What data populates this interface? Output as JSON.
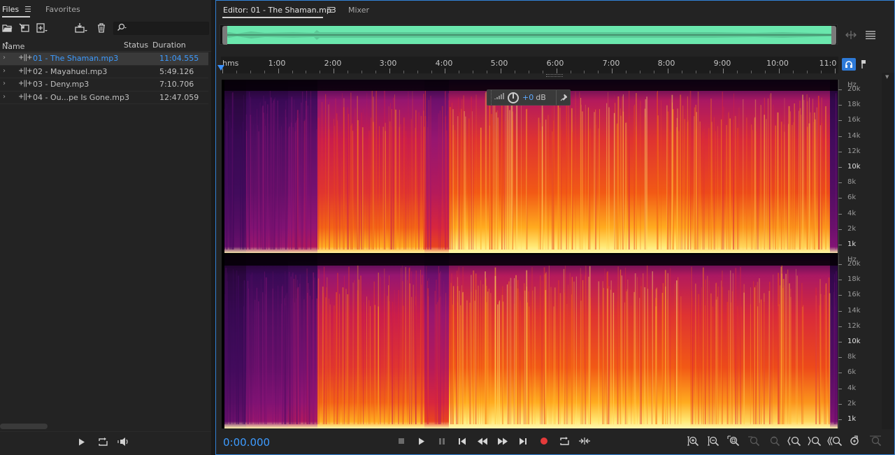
{
  "files_panel": {
    "tabs": [
      {
        "label": "Files",
        "active": true
      },
      {
        "label": "Favorites",
        "active": false
      }
    ],
    "toolbar": {
      "search_value": "",
      "icons": [
        "open-folder-icon",
        "import-icon",
        "new-file-icon",
        "insert-into-multitrack-icon",
        "delete-icon"
      ]
    },
    "columns": {
      "name": "Name",
      "sort_indicator": "↑",
      "status": "Status",
      "duration": "Duration"
    },
    "files": [
      {
        "name": "01 - The Shaman.mp3",
        "duration": "11:04.555",
        "selected": true
      },
      {
        "name": "02 - Mayahuel.mp3",
        "duration": "5:49.126",
        "selected": false
      },
      {
        "name": "03 - Deny.mp3",
        "duration": "7:10.706",
        "selected": false
      },
      {
        "name": "04 - Ou...pe Is Gone.mp3",
        "duration": "12:47.059",
        "selected": false
      }
    ]
  },
  "editor": {
    "tabs": [
      {
        "label": "Editor: 01 - The Shaman.mp3",
        "active": true
      },
      {
        "label": "Mixer",
        "active": false
      }
    ],
    "ruler": {
      "labels": [
        "hms",
        "1:00",
        "2:00",
        "3:00",
        "4:00",
        "5:00",
        "6:00",
        "7:00",
        "8:00",
        "9:00",
        "10:00",
        "11:0"
      ]
    },
    "hud": {
      "gain_value": "+0",
      "gain_unit": "dB"
    },
    "freq_axis": {
      "unit": "Hz",
      "labels": [
        "20k",
        "18k",
        "16k",
        "14k",
        "12k",
        "10k",
        "8k",
        "6k",
        "4k",
        "2k",
        "1k"
      ],
      "strong_labels": [
        "10k",
        "1k"
      ]
    },
    "timecode": "0:00.000",
    "colors": {
      "accent": "#3d9bff",
      "overview_wave": "#6ae7ad",
      "record": "#e43a3a"
    }
  }
}
